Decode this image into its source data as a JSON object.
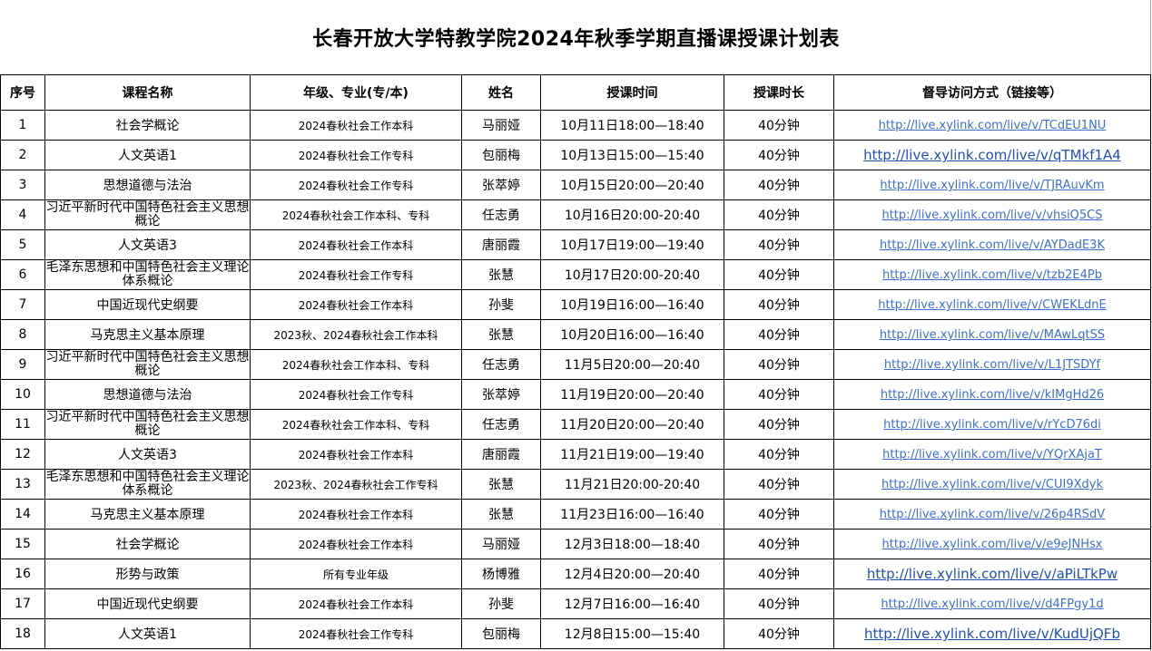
{
  "title": "长春开放大学特教学院2024年秋季学期直播课授课计划表",
  "columns": [
    "序号",
    "课程名称",
    "年级、专业(专/本)",
    "姓名",
    "授课时间",
    "授课时长",
    "督导访问方式（链接等）"
  ],
  "rows": [
    {
      "no": "1",
      "course": "社会学概论",
      "grade": "2024春秋社会工作本科",
      "teacher": "马丽娅",
      "time": "10月11日18:00—18:40",
      "duration": "40分钟",
      "link": "http://live.xylink.com/live/v/TCdEU1NU"
    },
    {
      "no": "2",
      "course": "人文英语1",
      "grade": "2024春秋社会工作专科",
      "teacher": "包丽梅",
      "time": "10月13日15:00—15:40",
      "duration": "40分钟",
      "link": "http://live.xylink.com/live/v/qTMkf1A4"
    },
    {
      "no": "3",
      "course": "思想道德与法治",
      "grade": "2024春秋社会工作专科",
      "teacher": "张萃婷",
      "time": "10月15日20:00—20:40",
      "duration": "40分钟",
      "link": "http://live.xylink.com/live/v/TJRAuvKm"
    },
    {
      "no": "4",
      "course": "习近平新时代中国特色社会主义思想概论",
      "grade": "2024春秋社会工作本科、专科",
      "teacher": "任志勇",
      "time": "10月16日20:00-20:40",
      "duration": "40分钟",
      "link": "http://live.xylink.com/live/v/vhsiQ5CS"
    },
    {
      "no": "5",
      "course": "人文英语3",
      "grade": "2024春秋社会工作本科",
      "teacher": "唐丽霞",
      "time": "10月17日19:00—19:40",
      "duration": "40分钟",
      "link": "http://live.xylink.com/live/v/AYDadE3K"
    },
    {
      "no": "6",
      "course": "毛泽东思想和中国特色社会主义理论体系概论",
      "grade": "2024春秋社会工作专科",
      "teacher": "张慧",
      "time": "10月17日20:00-20:40",
      "duration": "40分钟",
      "link": "http://live.xylink.com/live/v/tzb2E4Pb"
    },
    {
      "no": "7",
      "course": "中国近现代史纲要",
      "grade": "2024春秋社会工作本科",
      "teacher": "孙斐",
      "time": "10月19日16:00—16:40",
      "duration": "40分钟",
      "link": "http://live.xylink.com/live/v/CWEKLdnE"
    },
    {
      "no": "8",
      "course": "马克思主义基本原理",
      "grade": "2023秋、2024春秋社会工作本科",
      "teacher": "张慧",
      "time": "10月20日16:00—16:40",
      "duration": "40分钟",
      "link": "http://live.xylink.com/live/v/MAwLqtSS"
    },
    {
      "no": "9",
      "course": "习近平新时代中国特色社会主义思想概论",
      "grade": "2024春秋社会工作本科、专科",
      "teacher": "任志勇",
      "time": "11月5日20:00—20:40",
      "duration": "40分钟",
      "link": "http://live.xylink.com/live/v/L1JTSDYf"
    },
    {
      "no": "10",
      "course": "思想道德与法治",
      "grade": "2024春秋社会工作专科",
      "teacher": "张萃婷",
      "time": "11月19日20:00—20:40",
      "duration": "40分钟",
      "link": "http://live.xylink.com/live/v/kIMgHd26"
    },
    {
      "no": "11",
      "course": "习近平新时代中国特色社会主义思想概论",
      "grade": "2024春秋社会工作本科、专科",
      "teacher": "任志勇",
      "time": "11月20日20:00—20:40",
      "duration": "40分钟",
      "link": "http://live.xylink.com/live/v/rYcD76di"
    },
    {
      "no": "12",
      "course": "人文英语3",
      "grade": "2024春秋社会工作本科",
      "teacher": "唐丽霞",
      "time": "11月21日19:00—19:40",
      "duration": "40分钟",
      "link": "http://live.xylink.com/live/v/YQrXAjaT"
    },
    {
      "no": "13",
      "course": "毛泽东思想和中国特色社会主义理论体系概论",
      "grade": "2023秋、2024春秋社会工作专科",
      "teacher": "张慧",
      "time": "11月21日20:00-20:40",
      "duration": "40分钟",
      "link": "http://live.xylink.com/live/v/CUI9Xdyk"
    },
    {
      "no": "14",
      "course": "马克思主义基本原理",
      "grade": "2024春秋社会工作本科",
      "teacher": "张慧",
      "time": "11月23日16:00—16:40",
      "duration": "40分钟",
      "link": "http://live.xylink.com/live/v/26p4RSdV"
    },
    {
      "no": "15",
      "course": "社会学概论",
      "grade": "2024春秋社会工作本科",
      "teacher": "马丽娅",
      "time": "12月3日18:00—18:40",
      "duration": "40分钟",
      "link": "http://live.xylink.com/live/v/e9eJNHsx"
    },
    {
      "no": "16",
      "course": "形势与政策",
      "grade": "所有专业年级",
      "teacher": "杨博雅",
      "time": "12月4日20:00—20:40",
      "duration": "40分钟",
      "link": "http://live.xylink.com/live/v/aPiLTkPw"
    },
    {
      "no": "17",
      "course": "中国近现代史纲要",
      "grade": "2024春秋社会工作本科",
      "teacher": "孙斐",
      "time": "12月7日16:00—16:40",
      "duration": "40分钟",
      "link": "http://live.xylink.com/live/v/d4FPgy1d"
    },
    {
      "no": "18",
      "course": "人文英语1",
      "grade": "2024春秋社会工作专科",
      "teacher": "包丽梅",
      "time": "12月8日15:00—15:40",
      "duration": "40分钟",
      "link": "http://live.xylink.com/live/v/KudUjQFb"
    }
  ]
}
